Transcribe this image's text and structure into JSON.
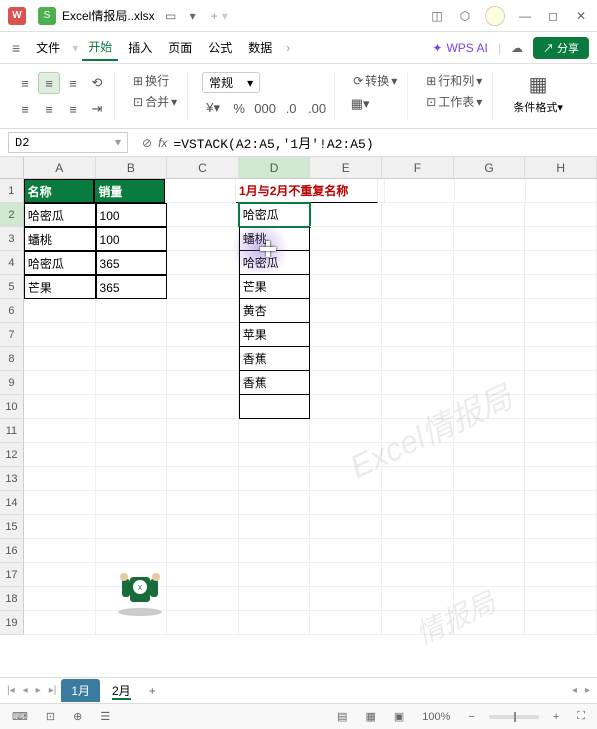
{
  "titlebar": {
    "logo": "W",
    "doc_icon": "S",
    "doc_name": "Excel情报局..xlsx",
    "add": "+"
  },
  "menubar": {
    "file": "文件",
    "tabs": [
      "开始",
      "插入",
      "页面",
      "公式",
      "数据"
    ],
    "active_tab": 0,
    "wps_ai": "WPS AI",
    "share": "分享"
  },
  "ribbon": {
    "wrap": "换行",
    "merge": "合并",
    "format_drop": "常规",
    "convert": "转换",
    "rowcol": "行和列",
    "worksheet": "工作表",
    "cond_fmt": "条件格式"
  },
  "namebox": {
    "ref": "D2",
    "formula": "=VSTACK(A2:A5,'1月'!A2:A5)"
  },
  "columns": [
    "A",
    "B",
    "C",
    "D",
    "E",
    "F",
    "G",
    "H"
  ],
  "table1": {
    "h1": "名称",
    "h2": "销量",
    "rows": [
      {
        "name": "哈密瓜",
        "qty": "100"
      },
      {
        "name": "蟠桃",
        "qty": "100"
      },
      {
        "name": "哈密瓜",
        "qty": "365"
      },
      {
        "name": "芒果",
        "qty": "365"
      }
    ]
  },
  "d_title": "1月与2月不重复名称",
  "d_values": [
    "哈密瓜",
    "蟠桃",
    "哈密瓜",
    "芒果",
    "黄杏",
    "苹果",
    "香蕉",
    "香蕉"
  ],
  "watermark": "Excel情报局",
  "watermark2": "情报局",
  "sheets": {
    "s1": "1月",
    "s2": "2月"
  },
  "status": {
    "zoom": "100%"
  }
}
